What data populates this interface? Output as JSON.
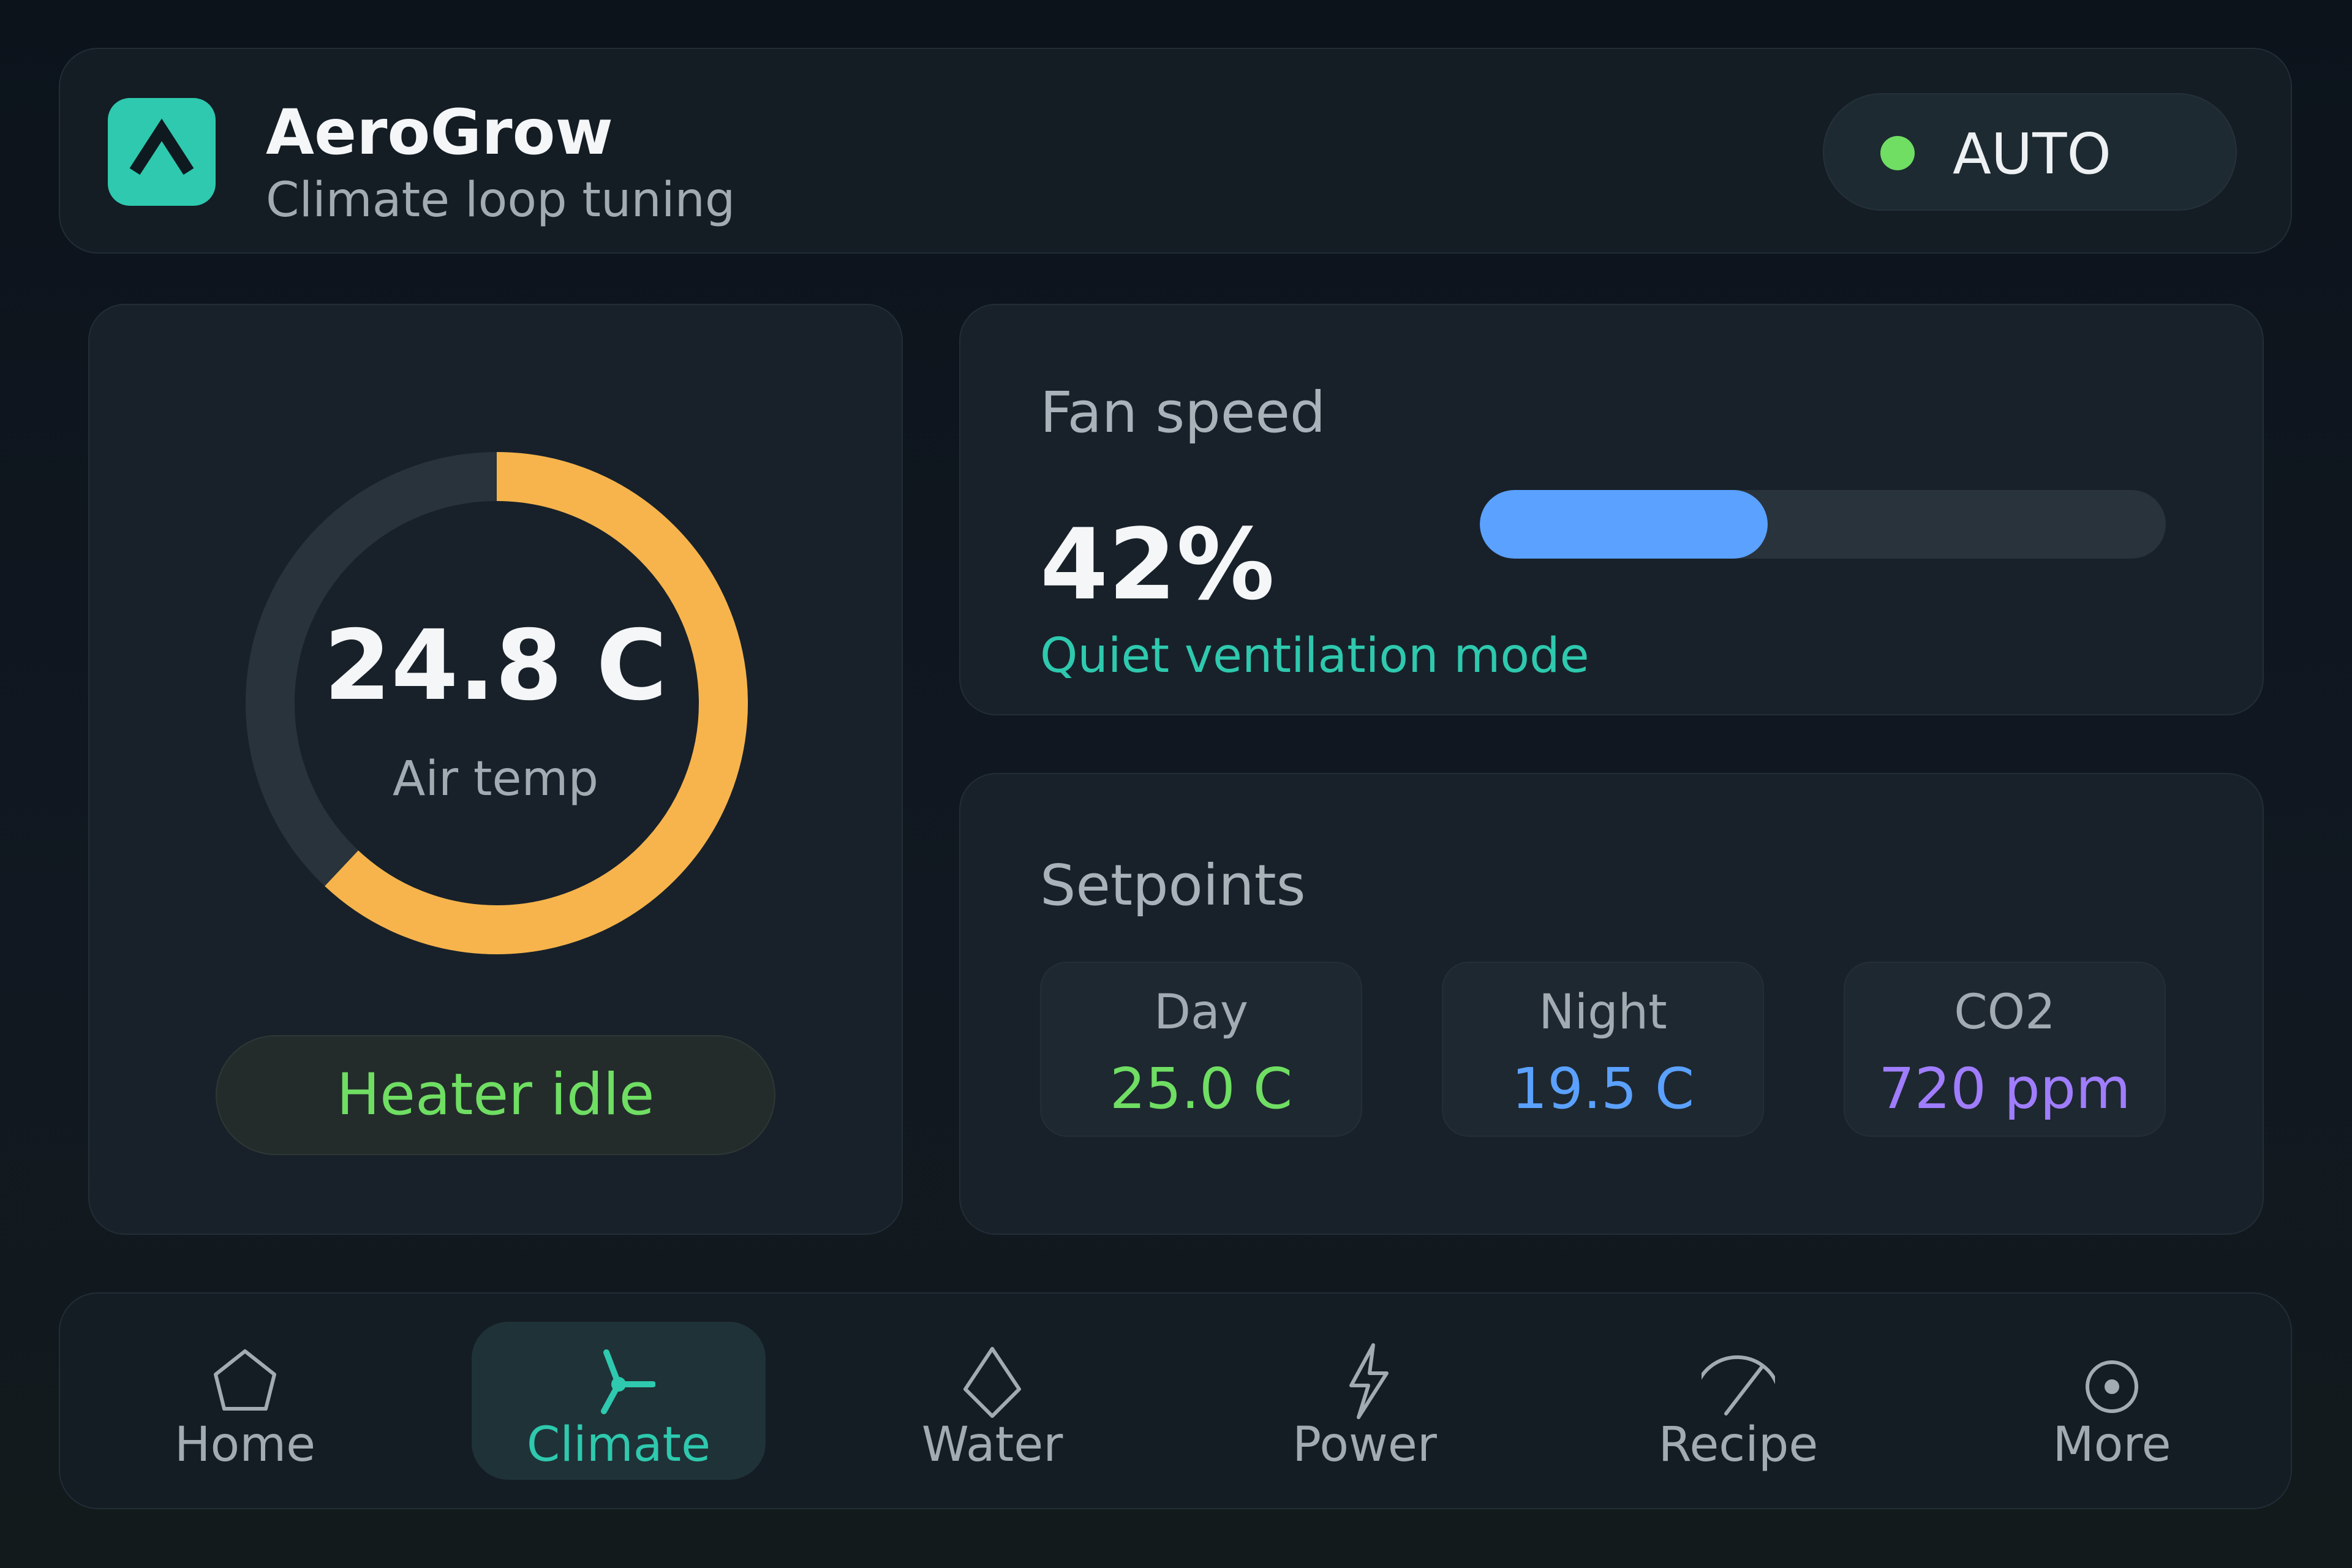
{
  "header": {
    "app_name": "AeroGrow",
    "subtitle": "Climate loop tuning",
    "logo_icon": "mountain-caret-icon",
    "mode": {
      "label": "AUTO",
      "indicator_color": "#6fde63"
    }
  },
  "temperature": {
    "value": "24.8 C",
    "label": "Air temp",
    "gauge_fraction": 0.62,
    "gauge_color": "#f7b44c",
    "status": "Heater idle"
  },
  "fan": {
    "title": "Fan speed",
    "value": "42%",
    "fraction": 0.42,
    "mode_note": "Quiet ventilation mode",
    "bar_color": "#5ba1ff"
  },
  "setpoints": {
    "title": "Setpoints",
    "items": [
      {
        "label": "Day",
        "value": "25.0 C",
        "color": "#6fde63"
      },
      {
        "label": "Night",
        "value": "19.5 C",
        "color": "#5ba1ff"
      },
      {
        "label": "CO2",
        "value": "720 ppm",
        "color": "#a07dff"
      }
    ]
  },
  "nav": {
    "accent": "#2ec9ae",
    "items": [
      {
        "label": "Home",
        "icon": "home-icon",
        "active": false
      },
      {
        "label": "Climate",
        "icon": "fan-icon",
        "active": true
      },
      {
        "label": "Water",
        "icon": "water-drop-icon",
        "active": false
      },
      {
        "label": "Power",
        "icon": "lightning-icon",
        "active": false
      },
      {
        "label": "Recipe",
        "icon": "recipe-arc-icon",
        "active": false
      },
      {
        "label": "More",
        "icon": "more-dot-icon",
        "active": false
      }
    ]
  }
}
